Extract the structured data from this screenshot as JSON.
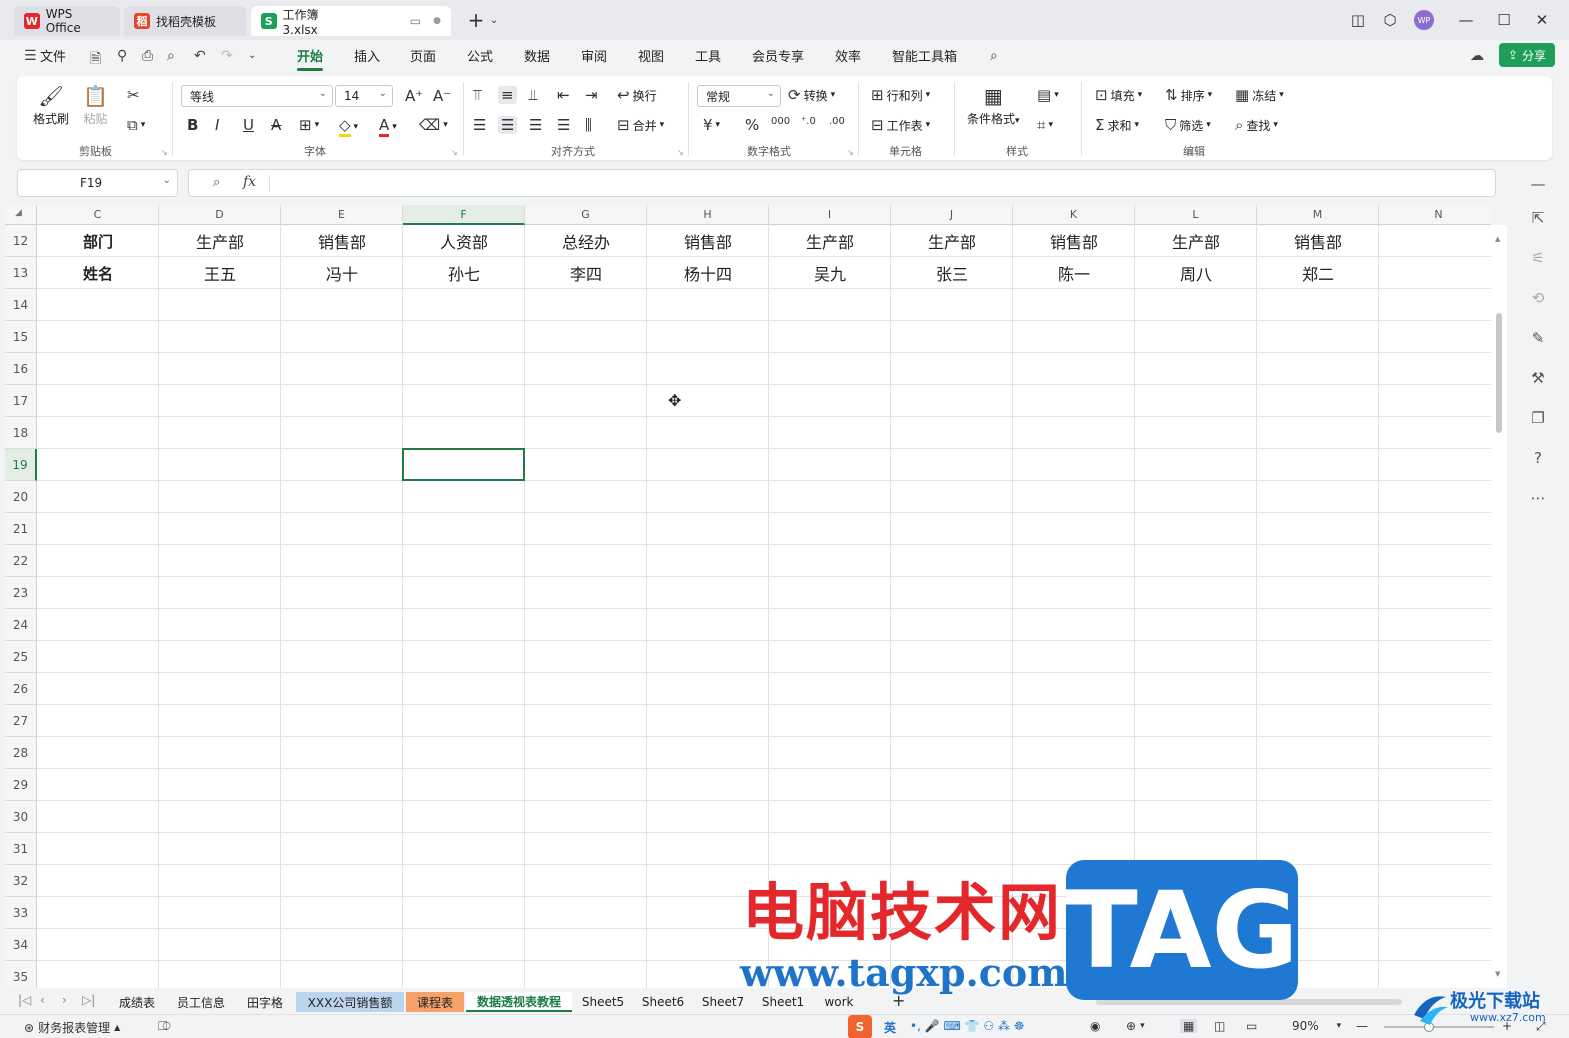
{
  "titlebar": {
    "tabs": [
      {
        "label": "WPS Office",
        "icon": "wps-logo",
        "color": "#e3272b"
      },
      {
        "label": "找稻壳模板",
        "icon": "docer-logo",
        "color": "#e3472b"
      },
      {
        "label": "工作簿3.xlsx",
        "icon": "spreadsheet-s",
        "color": "#1e9e59"
      }
    ],
    "avatar_text": "WP"
  },
  "menu": {
    "file": "文件",
    "items": [
      "开始",
      "插入",
      "页面",
      "公式",
      "数据",
      "审阅",
      "视图",
      "工具",
      "会员专享",
      "效率",
      "智能工具箱"
    ],
    "active": "开始",
    "share": "分享"
  },
  "ribbon": {
    "clipboard": {
      "label": "剪贴板",
      "format_painter": "格式刷",
      "paste": "粘贴"
    },
    "font": {
      "label": "字体",
      "font_name": "等线",
      "font_size": "14"
    },
    "align": {
      "label": "对齐方式",
      "wrap": "换行",
      "merge": "合并"
    },
    "number": {
      "label": "数字格式",
      "format": "常规",
      "convert": "转换"
    },
    "cells": {
      "label": "单元格",
      "rowcol": "行和列",
      "sheet": "工作表"
    },
    "style": {
      "label": "样式",
      "cond_format": "条件格式"
    },
    "edit": {
      "label": "编辑",
      "fill": "填充",
      "sort": "排序",
      "freeze": "冻结",
      "sum": "求和",
      "filter": "筛选",
      "find": "查找"
    }
  },
  "formula": {
    "cell_ref": "F19",
    "fx": "fx",
    "value": ""
  },
  "columns": [
    "C",
    "D",
    "E",
    "F",
    "G",
    "H",
    "I",
    "J",
    "K",
    "L",
    "M",
    "N"
  ],
  "selected_column": "F",
  "rows": [
    "12",
    "13",
    "14",
    "15",
    "16",
    "17",
    "18",
    "19",
    "20",
    "21",
    "22",
    "23",
    "24",
    "25",
    "26",
    "27",
    "28",
    "29",
    "30",
    "31",
    "32",
    "33",
    "34",
    "35"
  ],
  "selected_row": "19",
  "table": {
    "row12": [
      "部门",
      "生产部",
      "销售部",
      "人资部",
      "总经办",
      "销售部",
      "生产部",
      "生产部",
      "销售部",
      "生产部",
      "销售部"
    ],
    "row13": [
      "姓名",
      "王五",
      "冯十",
      "孙七",
      "李四",
      "杨十四",
      "吴九",
      "张三",
      "陈一",
      "周八",
      "郑二"
    ]
  },
  "sheets": [
    {
      "label": "成绩表",
      "style": "normal"
    },
    {
      "label": "员工信息",
      "style": "normal"
    },
    {
      "label": "田字格",
      "style": "normal"
    },
    {
      "label": "XXX公司销售额",
      "style": "blue"
    },
    {
      "label": "课程表",
      "style": "orange"
    },
    {
      "label": "数据透视表教程",
      "style": "active"
    },
    {
      "label": "Sheet5",
      "style": "normal"
    },
    {
      "label": "Sheet6",
      "style": "normal"
    },
    {
      "label": "Sheet7",
      "style": "normal"
    },
    {
      "label": "Sheet1",
      "style": "normal"
    },
    {
      "label": "work",
      "style": "normal"
    }
  ],
  "status": {
    "macro": "财务报表管理",
    "ime": "英",
    "zoom": "90%"
  },
  "watermark": {
    "title": "电脑技术网",
    "url": "www.tagxp.com",
    "tag": "TAG",
    "logo": "极光下载站",
    "logo_url": "www.xz7.com"
  }
}
